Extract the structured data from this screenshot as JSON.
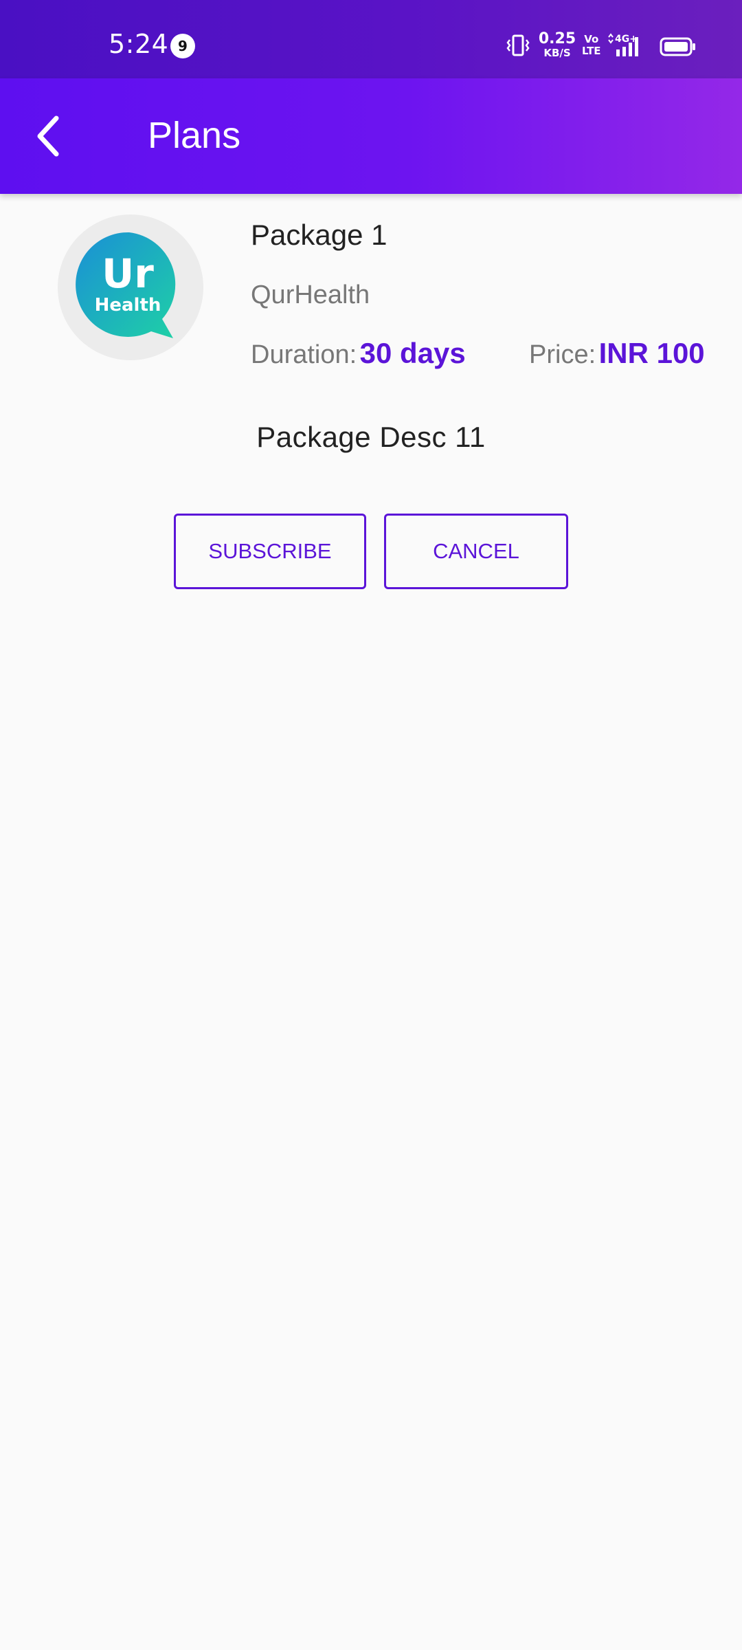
{
  "status_bar": {
    "time": "5:24",
    "notification_count": "9",
    "net_speed_value": "0.25",
    "net_speed_unit": "KB/S",
    "volte_top": "Vo",
    "volte_bottom": "LTE",
    "network_type": "4G+",
    "icons": [
      "vibrate-icon",
      "signal-icon",
      "battery-icon"
    ]
  },
  "app_bar": {
    "title": "Plans",
    "back_icon": "chevron-left-icon"
  },
  "package": {
    "name": "Package 1",
    "provider": "QurHealth",
    "logo_text_top": "Ur",
    "logo_text_bottom": "Health",
    "duration_label": "Duration:",
    "duration_value": "30 days",
    "price_label": "Price:",
    "price_value": "INR 100",
    "description": "Package Desc 11"
  },
  "actions": {
    "subscribe_label": "SUBSCRIBE",
    "cancel_label": "CANCEL"
  },
  "colors": {
    "accent": "#5b14d8",
    "status_bar": "#4a10c3",
    "app_bar_start": "#5e0ff0",
    "app_bar_end": "#9428e8",
    "background": "#fafafa"
  }
}
